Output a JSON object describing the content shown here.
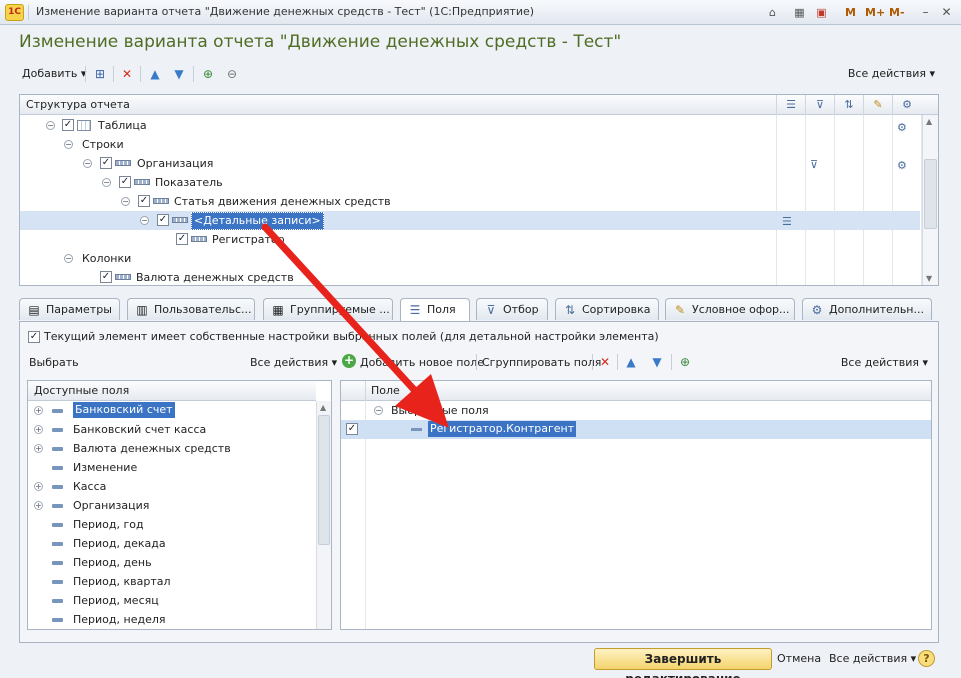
{
  "window": {
    "title": "Изменение варианта отчета \"Движение денежных средств - Тест\"  (1С:Предприятие)",
    "app_icon": "1С",
    "mem": [
      "M",
      "M+",
      "M-"
    ]
  },
  "form": {
    "title": "Изменение варианта отчета \"Движение денежных средств - Тест\""
  },
  "toolbar": {
    "add_label": "Добавить",
    "all_actions": "Все действия"
  },
  "structure": {
    "header": "Структура отчета",
    "rows": [
      {
        "label": "Таблица",
        "checked": true
      },
      {
        "label": "Строки"
      },
      {
        "label": "Организация",
        "checked": true
      },
      {
        "label": "Показатель",
        "checked": true
      },
      {
        "label": "Статья движения денежных средств",
        "checked": true
      },
      {
        "label": "<Детальные записи>",
        "checked": true,
        "selected": true
      },
      {
        "label": "Регистратор",
        "checked": true
      },
      {
        "label": "Колонки"
      },
      {
        "label": "Валюта денежных средств",
        "checked": true
      }
    ]
  },
  "tabs": [
    {
      "label": "Параметры"
    },
    {
      "label": "Пользовательс..."
    },
    {
      "label": "Группируемые ..."
    },
    {
      "label": "Поля",
      "active": true
    },
    {
      "label": "Отбор"
    },
    {
      "label": "Сортировка"
    },
    {
      "label": "Условное офор..."
    },
    {
      "label": "Дополнительн..."
    }
  ],
  "fields_tab": {
    "own_settings_label": "Текущий элемент имеет собственные настройки выбранных полей (для детальной настройки элемента)",
    "own_settings_checked": true,
    "choose_label": "Выбрать",
    "left_all_actions": "Все действия",
    "add_field": "Добавить новое поле",
    "group_fields": "Сгруппировать поля",
    "right_all_actions": "Все действия",
    "available_header": "Доступные поля",
    "available": [
      {
        "label": "Банковский счет",
        "expandable": true,
        "selected": true
      },
      {
        "label": "Банковский счет касса",
        "expandable": true
      },
      {
        "label": "Валюта денежных средств",
        "expandable": true
      },
      {
        "label": "Изменение",
        "expandable": false
      },
      {
        "label": "Касса",
        "expandable": true
      },
      {
        "label": "Организация",
        "expandable": true
      },
      {
        "label": "Период, год",
        "expandable": false
      },
      {
        "label": "Период, декада",
        "expandable": false
      },
      {
        "label": "Период, день",
        "expandable": false
      },
      {
        "label": "Период, квартал",
        "expandable": false
      },
      {
        "label": "Период, месяц",
        "expandable": false
      },
      {
        "label": "Период, неделя",
        "expandable": false
      }
    ],
    "selected_header": "Поле",
    "selected_group": "Выбранные поля",
    "selected_items": [
      {
        "label": "Регистратор.Контрагент",
        "checked": true
      }
    ]
  },
  "footer": {
    "finish": "Завершить редактирование",
    "cancel": "Отмена",
    "all_actions": "Все действия",
    "help": "?"
  },
  "colors": {
    "title_green": "#4f6d24",
    "selection_blue": "#3b74c4",
    "arrow_red": "#e8231b",
    "finish_yellow": "#f3d36b"
  }
}
